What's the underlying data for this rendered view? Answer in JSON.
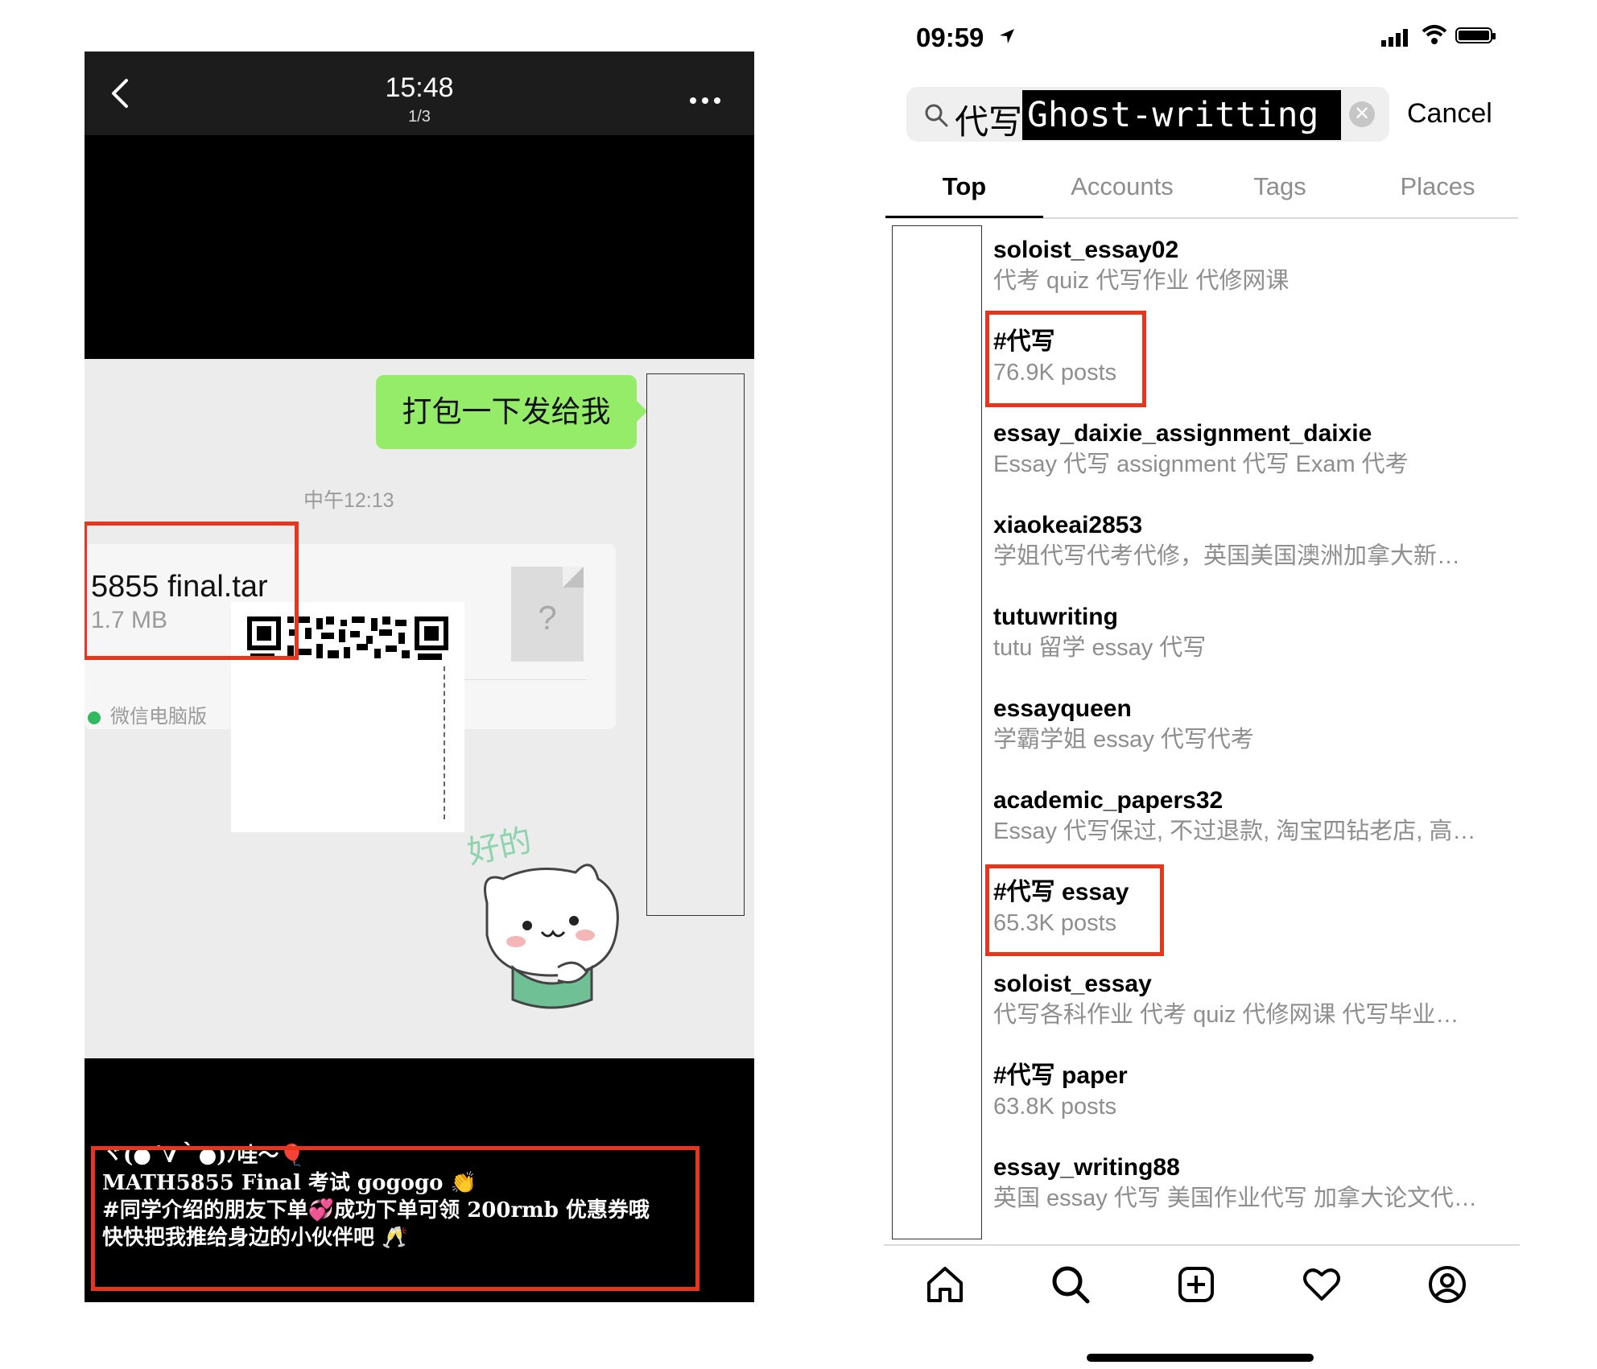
{
  "left_panel": {
    "header": {
      "time": "15:48",
      "page": "1/3"
    },
    "chat": {
      "sent_message": "打包一下发给我",
      "timestamp": "中午12:13",
      "file": {
        "name": "5855 final.tar",
        "size": "1.7 MB",
        "icon": "unknown-file-icon",
        "icon_glyph": "?"
      },
      "source_app": "微信电脑版",
      "sticker_text": "好的"
    },
    "caption": [
      "ヾ(●´∇｀●)ﾉ哇～🎈",
      "MATH5855 Final 考试 gogogo 👏",
      "#同学介绍的朋友下单💞成功下单可领 200rmb 优惠券哦",
      "快快把我推给身边的小伙伴吧 🥂"
    ],
    "highlight_color": "#e8361e"
  },
  "right_panel": {
    "status_bar": {
      "time": "09:59"
    },
    "search": {
      "query_prefix": "代写",
      "query_highlight": "Ghost-writting",
      "cancel_label": "Cancel"
    },
    "tabs": [
      {
        "label": "Top",
        "active": true
      },
      {
        "label": "Accounts",
        "active": false
      },
      {
        "label": "Tags",
        "active": false
      },
      {
        "label": "Places",
        "active": false
      }
    ],
    "results": [
      {
        "name": "soloist_essay02",
        "sub": "代考 quiz 代写作业 代修网课",
        "highlighted": false
      },
      {
        "name": "#代写",
        "sub": "76.9K posts",
        "highlighted": true
      },
      {
        "name": "essay_daixie_assignment_daixie",
        "sub": "Essay 代写 assignment 代写 Exam 代考",
        "highlighted": false
      },
      {
        "name": "xiaokeai2853",
        "sub": "学姐代写代考代修，英国美国澳洲加拿大新…",
        "highlighted": false
      },
      {
        "name": "tutuwriting",
        "sub": "tutu 留学 essay 代写",
        "highlighted": false
      },
      {
        "name": "essayqueen",
        "sub": "学霸学姐 essay 代写代考",
        "highlighted": false
      },
      {
        "name": "academic_papers32",
        "sub": "Essay 代写保过, 不过退款, 淘宝四钻老店, 高…",
        "highlighted": false
      },
      {
        "name": "#代写 essay",
        "sub": "65.3K posts",
        "highlighted": true
      },
      {
        "name": "soloist_essay",
        "sub": "代写各科作业 代考 quiz 代修网课 代写毕业…",
        "highlighted": false
      },
      {
        "name": "#代写 paper",
        "sub": "63.8K posts",
        "highlighted": false
      },
      {
        "name": "essay_writing88",
        "sub": "英国 essay 代写 美国作业代写 加拿大论文代…",
        "highlighted": false
      }
    ],
    "bottom_nav": [
      "home-icon",
      "search-icon",
      "new-post-icon",
      "activity-heart-icon",
      "profile-icon"
    ]
  }
}
